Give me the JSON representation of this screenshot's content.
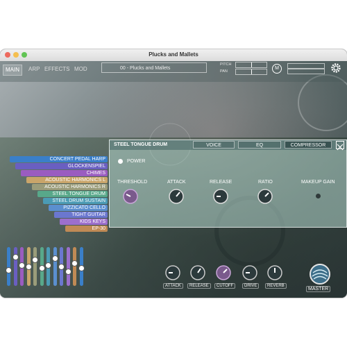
{
  "window": {
    "title": "Plucks and Mallets"
  },
  "nav": {
    "tabs": [
      "MAIN",
      "ARP",
      "EFFECTS",
      "MOD"
    ],
    "active": "MAIN"
  },
  "preset": {
    "name": "00 - Plucks and Mallets"
  },
  "header": {
    "pitch_label": "PITCH",
    "pan_label": "PAN",
    "m_button": "M"
  },
  "instruments": [
    {
      "name": "CONCERT PEDAL HARP",
      "color": "#3a7fc9"
    },
    {
      "name": "GLOCKENSPIEL",
      "color": "#6a5fc1"
    },
    {
      "name": "CHIMES",
      "color": "#9a5cc0"
    },
    {
      "name": "ACOUSTIC HARMONICS L",
      "color": "#c9a56a"
    },
    {
      "name": "ACOUSTIC HARMONICS R",
      "color": "#9a9c7a"
    },
    {
      "name": "STEEL TONGUE DRUM",
      "color": "#58a88a"
    },
    {
      "name": "STEEL DRUM SUSTAIN",
      "color": "#4b9bb5"
    },
    {
      "name": "PIZZICATO CELLO",
      "color": "#5b8fcf"
    },
    {
      "name": "TIGHT GUITAR",
      "color": "#6b77cf"
    },
    {
      "name": "KIDS KEYS",
      "color": "#9c6fcc"
    },
    {
      "name": "EP-30",
      "color": "#c08a55"
    }
  ],
  "mixer": {
    "levels": [
      0.4,
      0.8,
      0.55,
      0.5,
      0.7,
      0.45,
      0.55,
      0.75,
      0.5,
      0.35,
      0.6,
      0.45
    ]
  },
  "compressor_panel": {
    "title": "STEEL TONGUE DRUM",
    "tabs": [
      "VOICE",
      "EQ",
      "COMPRESSOR"
    ],
    "active_tab": "COMPRESSOR",
    "power_label": "POWER",
    "knobs": [
      {
        "label": "THRESHOLD"
      },
      {
        "label": "ATTACK"
      },
      {
        "label": "RELEASE"
      },
      {
        "label": "RATIO"
      },
      {
        "label": "MAKEUP GAIN"
      }
    ]
  },
  "bottom_knobs": [
    "ATTACK",
    "RELEASE",
    "CUTOFF",
    "DRIVE",
    "REVERB"
  ],
  "master": {
    "label": "MASTER"
  }
}
